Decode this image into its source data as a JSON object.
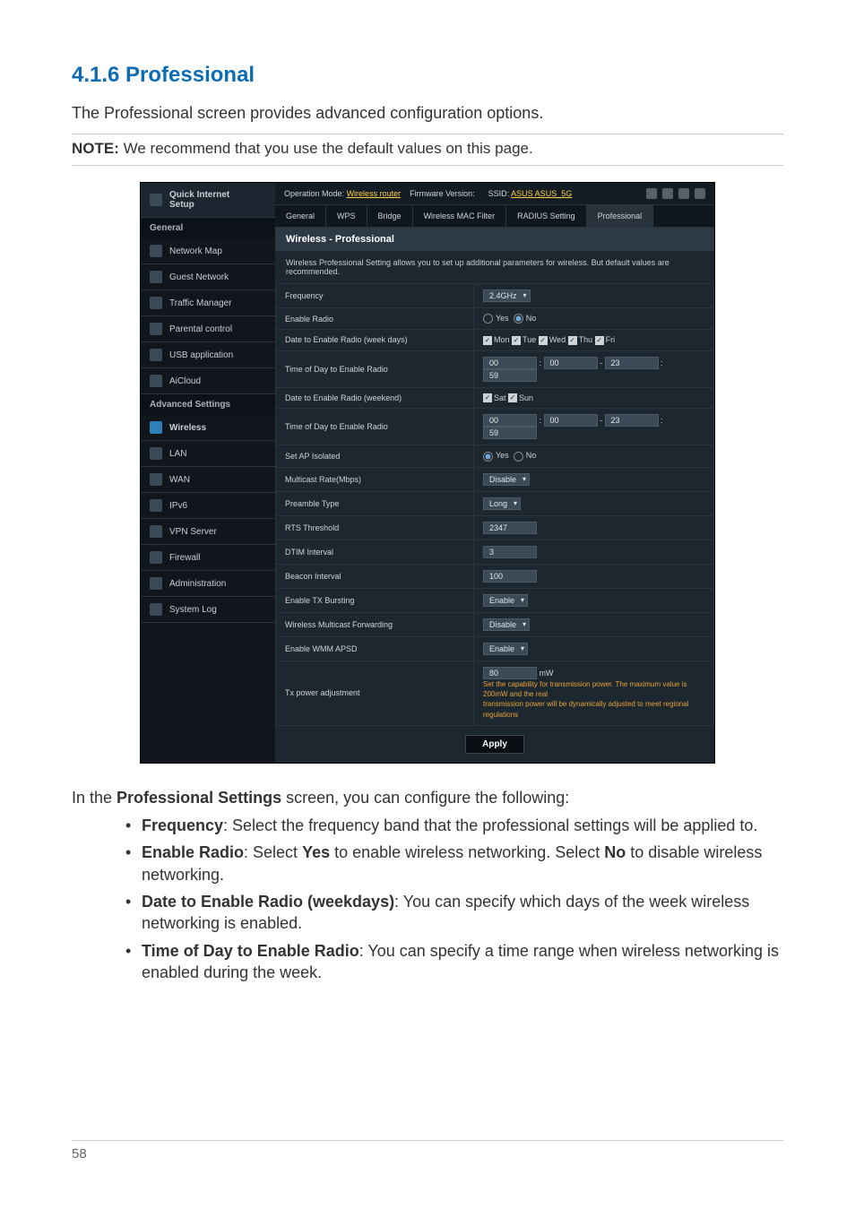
{
  "section_title": "4.1.6 Professional",
  "lead": "The Professional screen provides advanced configuration options.",
  "note_label": "NOTE:",
  "note_text": "We recommend that you use the default values on this page.",
  "screenshot": {
    "topbar": {
      "op_mode_label": "Operation Mode:",
      "op_mode_value": "Wireless router",
      "fw_label": "Firmware Version:",
      "ssid_label": "SSID:",
      "ssid_value": "ASUS ASUS_5G"
    },
    "side": {
      "qis_l1": "Quick Internet",
      "qis_l2": "Setup",
      "head_general": "General",
      "items_general": [
        "Network Map",
        "Guest Network",
        "Traffic Manager",
        "Parental control",
        "USB application",
        "AiCloud"
      ],
      "head_adv": "Advanced Settings",
      "items_adv": [
        "Wireless",
        "LAN",
        "WAN",
        "IPv6",
        "VPN Server",
        "Firewall",
        "Administration",
        "System Log"
      ]
    },
    "tabs": [
      "General",
      "WPS",
      "Bridge",
      "Wireless MAC Filter",
      "RADIUS Setting",
      "Professional"
    ],
    "panel_title": "Wireless - Professional",
    "panel_desc": "Wireless Professional Setting allows you to set up additional parameters for wireless. But default values are recommended.",
    "rows": {
      "frequency_l": "Frequency",
      "frequency_v": "2.4GHz",
      "enable_radio_l": "Enable Radio",
      "yes": "Yes",
      "no": "No",
      "date_week_l": "Date to Enable Radio (week days)",
      "mon": "Mon",
      "tue": "Tue",
      "wed": "Wed",
      "thu": "Thu",
      "fri": "Fri",
      "tod_week_l": "Time of Day to Enable Radio",
      "t00": "00",
      "t23": "23",
      "t59": "59",
      "date_wk_l": "Date to Enable Radio (weekend)",
      "sat": "Sat",
      "sun": "Sun",
      "tod_wk_l": "Time of Day to Enable Radio",
      "ap_iso_l": "Set AP Isolated",
      "mcast_l": "Multicast Rate(Mbps)",
      "disable": "Disable",
      "preamble_l": "Preamble Type",
      "long": "Long",
      "rts_l": "RTS Threshold",
      "rts_v": "2347",
      "dtim_l": "DTIM Interval",
      "dtim_v": "3",
      "beacon_l": "Beacon Interval",
      "beacon_v": "100",
      "txburst_l": "Enable TX Bursting",
      "enable": "Enable",
      "mfwd_l": "Wireless Multicast Forwarding",
      "wmm_l": "Enable WMM APSD",
      "txp_l": "Tx power adjustment",
      "txp_v": "80",
      "txp_unit": "mW",
      "txp_note1": "Set the capability for transmission power. The maximum value is 200mW and the real",
      "txp_note2": "transmission power will be dynamically adjusted to meet regional regulations"
    },
    "apply": "Apply"
  },
  "paragraph_after": {
    "l1_a": "In the ",
    "l1_b": "Professional Settings",
    "l1_c": " screen, you can configure the following:"
  },
  "bullets": {
    "b1_a": "Frequency",
    "b1_b": ":  Select the frequency band that the professional settings will be applied to.",
    "b2_a": "Enable Radio",
    "b2_b": ":  Select ",
    "b2_c": "Yes",
    "b2_d": " to enable wireless networking. Select ",
    "b2_e": "No",
    "b2_f": " to disable wireless networking.",
    "b3_a": "Date to Enable Radio (weekdays)",
    "b3_b": ":  You can specify which days of the week wireless networking is enabled.",
    "b4_a": "Time of Day to Enable Radio",
    "b4_b": ":  You can specify a time range when wireless networking is enabled during the week."
  },
  "page_number": "58"
}
